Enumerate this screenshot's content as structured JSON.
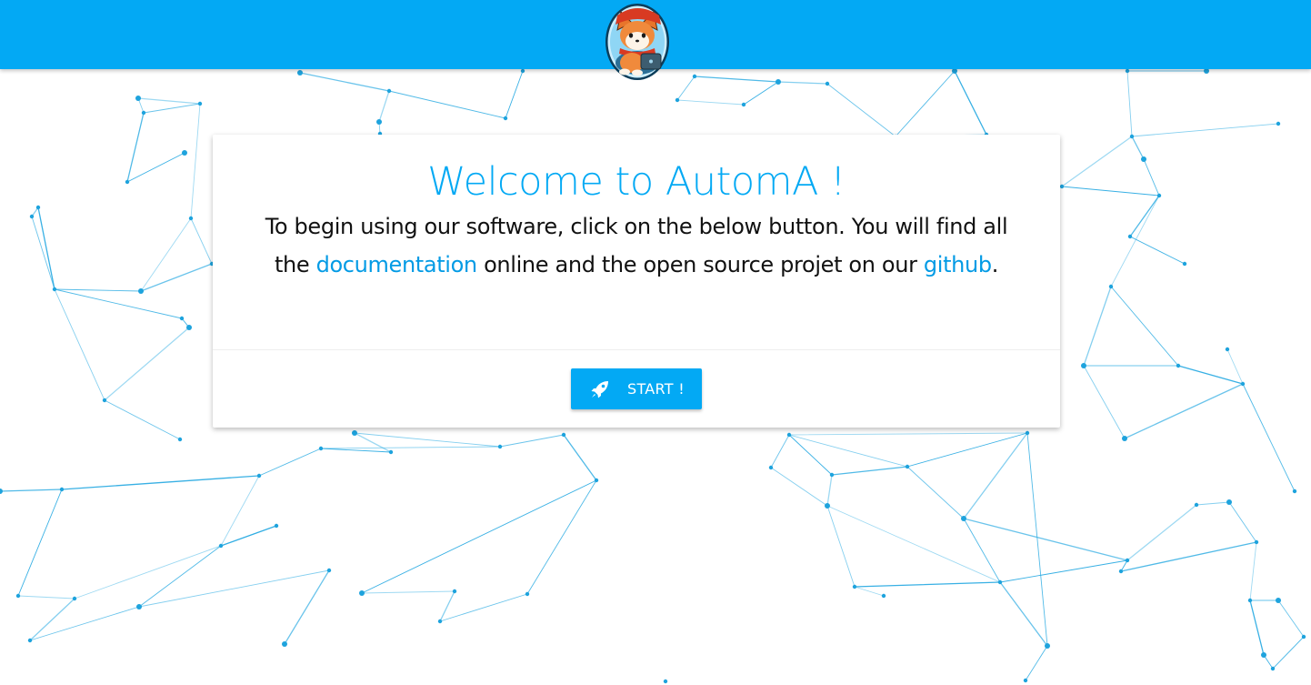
{
  "header": {
    "logo_name": "fox-mascot-logo",
    "color": "#03a9f4"
  },
  "card": {
    "title": "Welcome to AutomA !",
    "text_before": "To begin using our software, click on the below button. You will find all the ",
    "documentation_link": "documentation",
    "text_middle": " online and the open source projet on our ",
    "github_link": "github",
    "text_after": ".",
    "start_button": {
      "label": "START !",
      "icon": "rocket-icon"
    }
  },
  "background": {
    "icon": "network-pattern",
    "color": "#29aae2"
  }
}
